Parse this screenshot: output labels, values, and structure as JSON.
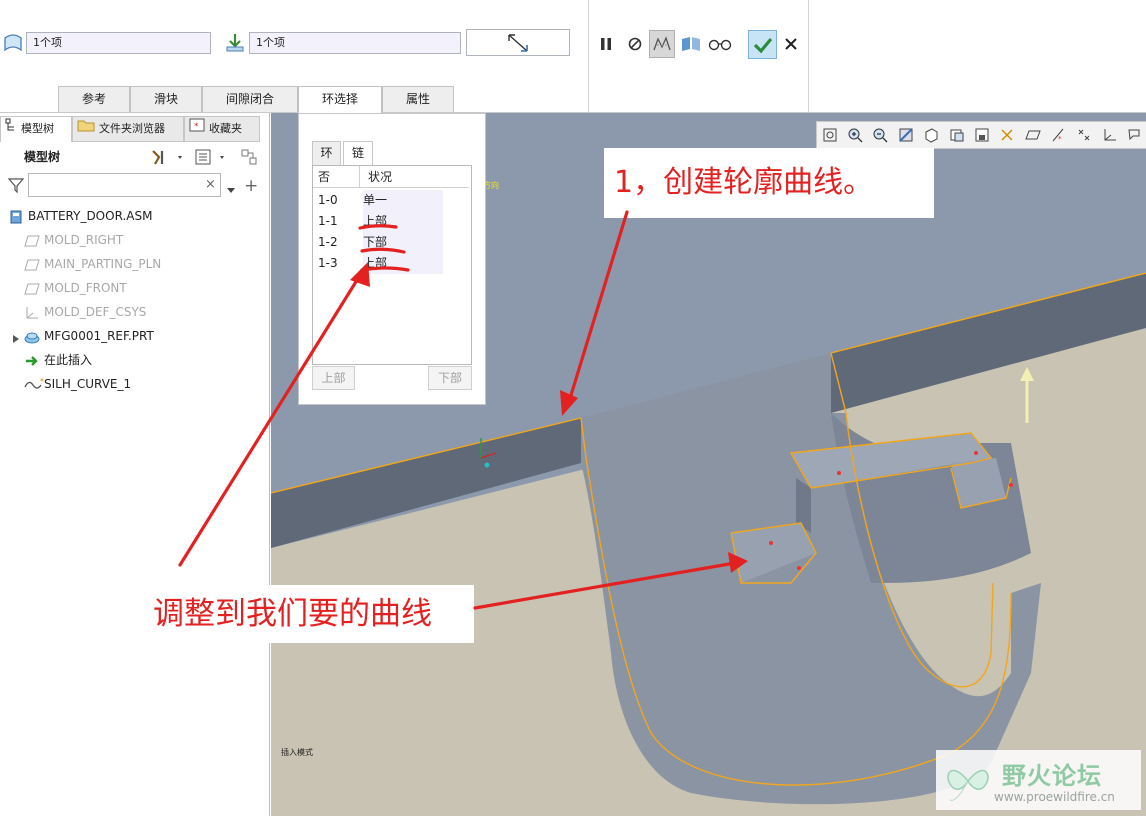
{
  "dashboard": {
    "ref_field_1": "1个项",
    "ref_field_2": "1个项",
    "tabs": [
      {
        "label": "参考"
      },
      {
        "label": "滑块"
      },
      {
        "label": "间隙闭合"
      },
      {
        "label": "环选择"
      },
      {
        "label": "属性"
      }
    ],
    "active_tab": "环选择",
    "icons": [
      "surface-icon",
      "download-arrow-icon",
      "scale-arrows-icon",
      "pause-icon",
      "cancel-circle-icon",
      "verify-icon",
      "preview-icon",
      "glasses-icon",
      "confirm-check-icon",
      "close-x-icon"
    ],
    "accent_color": "#2e8b3c"
  },
  "left_panel": {
    "tabs": [
      {
        "label": "模型树"
      },
      {
        "label": "文件夹浏览器"
      },
      {
        "label": "收藏夹"
      }
    ],
    "header": "模型树",
    "search_placeholder": "",
    "tree": [
      {
        "label": "BATTERY_DOOR.ASM",
        "icon": "assembly-icon"
      },
      {
        "label": "MOLD_RIGHT",
        "icon": "datum-plane-icon"
      },
      {
        "label": "MAIN_PARTING_PLN",
        "icon": "datum-plane-icon"
      },
      {
        "label": "MOLD_FRONT",
        "icon": "datum-plane-icon"
      },
      {
        "label": "MOLD_DEF_CSYS",
        "icon": "csys-icon"
      },
      {
        "label": "MFG0001_REF.PRT",
        "icon": "part-icon"
      },
      {
        "label": "在此插入",
        "icon": "insert-here-arrow-icon"
      },
      {
        "label": "SILH_CURVE_1",
        "icon": "curve-icon"
      }
    ]
  },
  "chain_panel": {
    "tabs": [
      {
        "label": "环"
      },
      {
        "label": "链"
      }
    ],
    "columns": [
      "否",
      "状况"
    ],
    "rows": [
      {
        "id": "1-0",
        "status": "单一"
      },
      {
        "id": "1-1",
        "status": "上部"
      },
      {
        "id": "1-2",
        "status": "下部"
      },
      {
        "id": "1-3",
        "status": "上部"
      }
    ],
    "up_button": "上部",
    "down_button": "下部"
  },
  "viewport": {
    "view_label": "方向",
    "mode_label": "插入模式",
    "colors": {
      "background": "#8c99ac",
      "curve": "#f2a61c",
      "floor": "#c8c2b2"
    }
  },
  "annotations": {
    "note_1": "1，创建轮廓曲线。",
    "note_2": "调整到我们要的曲线",
    "color": "#e32121"
  },
  "watermark": {
    "title": "野火论坛",
    "url": "www.proewildfire.cn"
  }
}
